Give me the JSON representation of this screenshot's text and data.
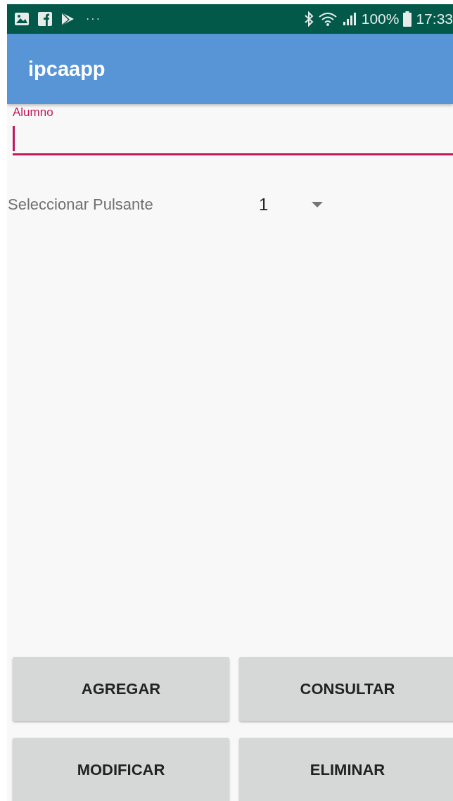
{
  "status_bar": {
    "more": "···",
    "battery": "100%",
    "time": "17:33"
  },
  "app_bar": {
    "title": "ipcaapp"
  },
  "field": {
    "label": "Alumno",
    "focused": true
  },
  "spinner": {
    "label": "Seleccionar Pulsante",
    "value": "1"
  },
  "buttons": [
    "AGREGAR",
    "CONSULTAR",
    "MODIFICAR",
    "ELIMINAR"
  ]
}
